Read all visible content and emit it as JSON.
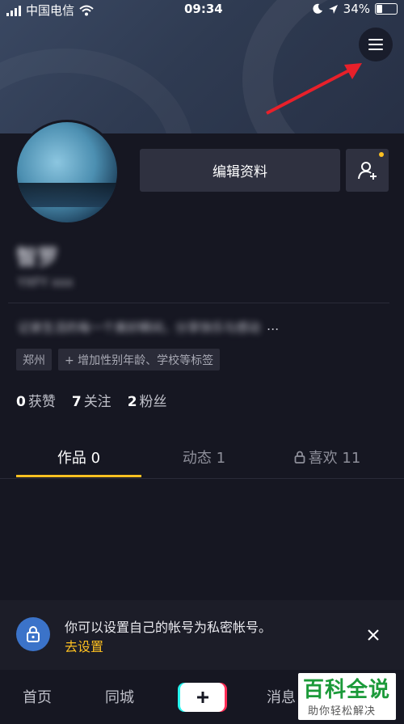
{
  "status_bar": {
    "carrier": "中国电信",
    "time": "09:34",
    "battery": "34%",
    "battery_level": 0.34
  },
  "profile": {
    "edit_button": "编辑资料",
    "username": "智罗",
    "user_id": "YXFY xxx",
    "bio": "记录生活的每一个美好瞬间，分享快乐与感动",
    "bio_ellipsis": "...",
    "location_tag": "郑州",
    "add_info_tag": "+ 增加性别年龄、学校等标签"
  },
  "stats": [
    {
      "num": "0",
      "label": "获赞"
    },
    {
      "num": "7",
      "label": "关注"
    },
    {
      "num": "2",
      "label": "粉丝"
    }
  ],
  "tabs": {
    "works": "作品 0",
    "activity": "动态 1",
    "likes": "喜欢 11"
  },
  "private_banner": {
    "text": "你可以设置自己的帐号为私密帐号。",
    "link": "去设置"
  },
  "bottom_nav": {
    "home": "首页",
    "city": "同城",
    "messages": "消息"
  },
  "watermark": {
    "title": "百科全说",
    "subtitle": "助你轻松解决"
  },
  "colors": {
    "accent": "#fdc021",
    "background": "#161722",
    "arrow": "#e8202a"
  }
}
